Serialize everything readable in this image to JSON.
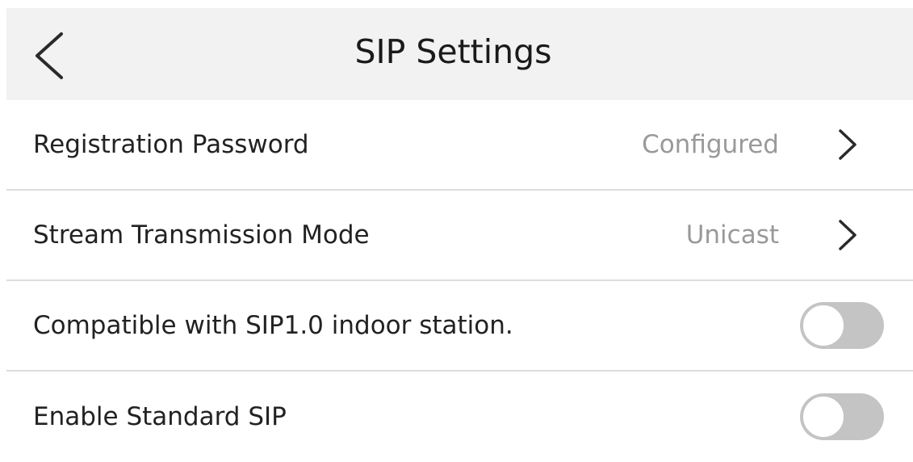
{
  "header": {
    "title": "SIP Settings",
    "back_icon": "chevron-left-icon"
  },
  "settings": [
    {
      "label": "Registration Password",
      "value": "Configured",
      "type": "link",
      "icon": "chevron-right-icon"
    },
    {
      "label": "Stream Transmission Mode",
      "value": "Unicast",
      "type": "link",
      "icon": "chevron-right-icon"
    },
    {
      "label": "Compatible with SIP1.0 indoor station.",
      "type": "toggle",
      "enabled": false
    },
    {
      "label": "Enable Standard SIP",
      "type": "toggle",
      "enabled": false
    }
  ],
  "colors": {
    "header_background": "#f2f2f2",
    "value_text": "#999999",
    "toggle_off": "#c4c4c4",
    "divider": "#dcdcdc"
  }
}
